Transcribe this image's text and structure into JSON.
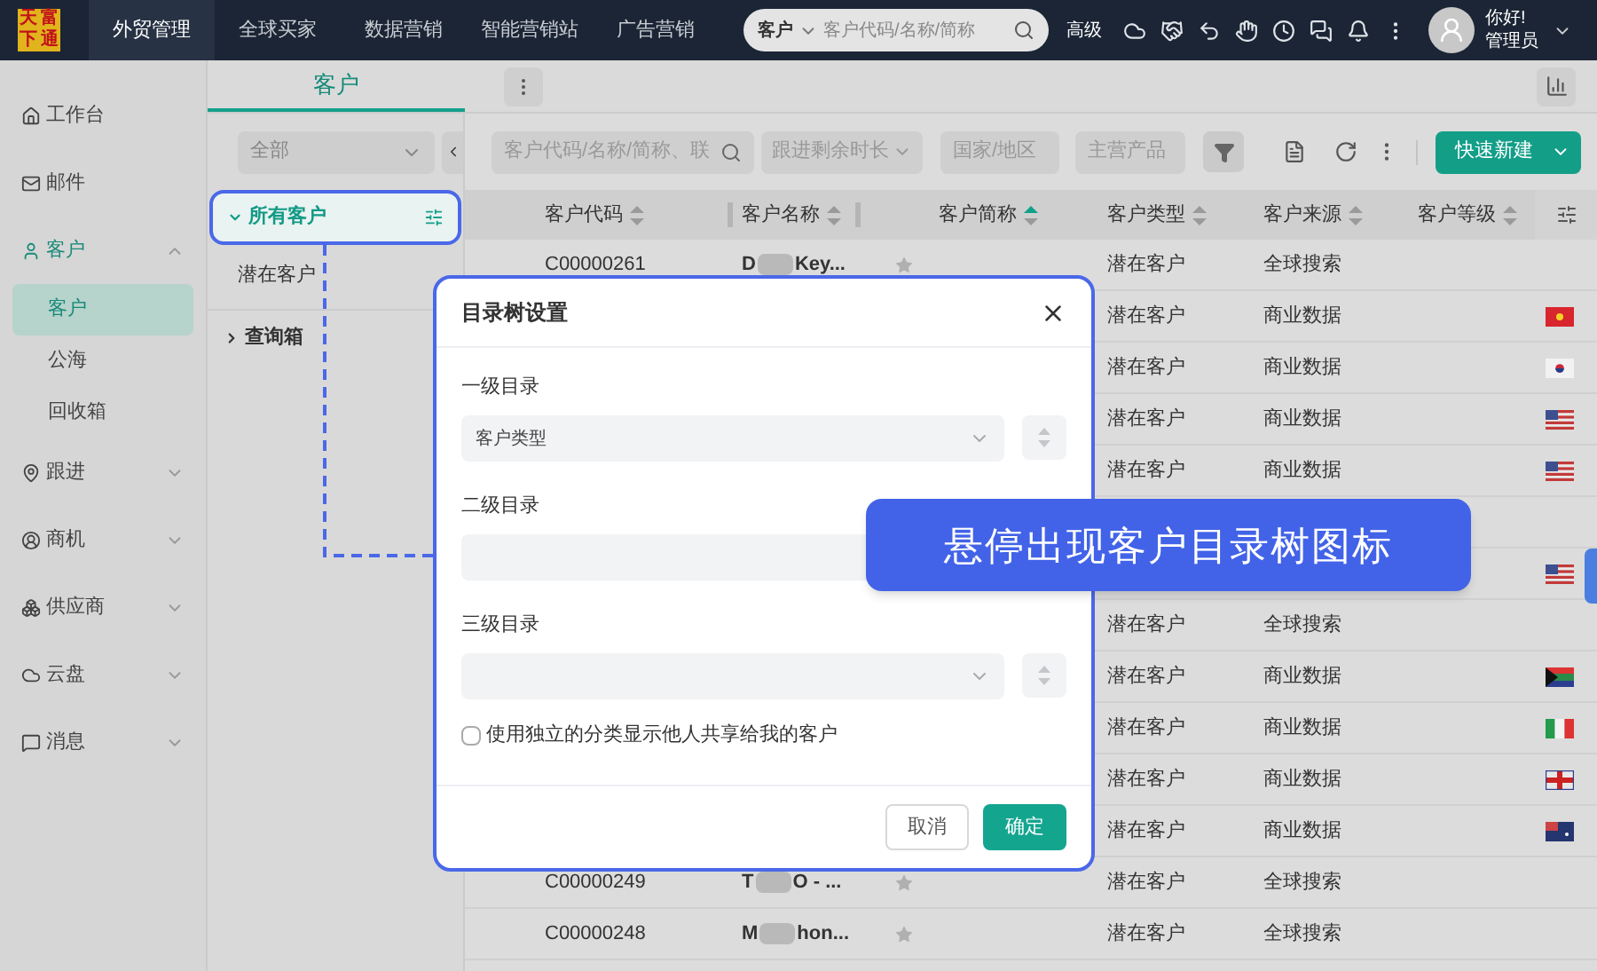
{
  "top_nav": {
    "logo": [
      "天",
      "富",
      "下",
      "通"
    ],
    "items": [
      {
        "label": "外贸管理",
        "selected": true
      },
      {
        "label": "全球买家",
        "selected": false
      },
      {
        "label": "数据营销",
        "selected": false
      },
      {
        "label": "智能营销站",
        "selected": false
      },
      {
        "label": "广告营销",
        "selected": false
      }
    ],
    "search": {
      "scope": "客户",
      "placeholder": "客户代码/名称/简称"
    },
    "advanced": "高级",
    "greeting": "你好!",
    "role": "管理员"
  },
  "sidebar": {
    "items": [
      {
        "label": "工作台"
      },
      {
        "label": "邮件"
      },
      {
        "label": "客户",
        "expanded": true,
        "children": [
          {
            "label": "客户",
            "selected": true
          },
          {
            "label": "公海",
            "selected": false
          },
          {
            "label": "回收箱",
            "selected": false
          }
        ]
      },
      {
        "label": "跟进",
        "expanded": false
      },
      {
        "label": "商机",
        "expanded": false
      },
      {
        "label": "供应商",
        "expanded": false
      },
      {
        "label": "云盘",
        "expanded": false
      },
      {
        "label": "消息",
        "expanded": false
      }
    ]
  },
  "tabs": [
    {
      "label": "客户",
      "selected": true
    }
  ],
  "tree": {
    "filter": "全部",
    "items": [
      {
        "label": "所有客户",
        "selected": true,
        "expanded": true,
        "children": [
          {
            "label": "潜在客户",
            "selected": false
          }
        ]
      },
      {
        "label": "查询箱",
        "selected": false,
        "expanded": false
      }
    ]
  },
  "toolbar": {
    "search_placeholder": "客户代码/名称/简称、联",
    "follow_select": "跟进剩余时长",
    "country_placeholder": "国家/地区",
    "product_placeholder": "主营产品",
    "new_button": "快速新建"
  },
  "table": {
    "columns": [
      {
        "label": "客户代码",
        "sorted": false
      },
      {
        "label": "客户名称",
        "sorted": false
      },
      {
        "label": "客户简称",
        "sorted": true
      },
      {
        "label": "客户类型",
        "sorted": false
      },
      {
        "label": "客户来源",
        "sorted": false
      },
      {
        "label": "客户等级",
        "sorted": false
      }
    ],
    "rows": [
      {
        "code": "C00000261",
        "name_start": "D",
        "name_end": "Key...",
        "starred": false,
        "type": "潜在客户",
        "source": "全球搜索"
      },
      {
        "type": "潜在客户",
        "source": "商业数据",
        "flag": {
          "kind": "vn"
        }
      },
      {
        "type": "潜在客户",
        "source": "商业数据",
        "flag": {
          "kind": "kr"
        }
      },
      {
        "type": "潜在客户",
        "source": "商业数据",
        "flag": {
          "kind": "us"
        }
      },
      {
        "type": "潜在客户",
        "source": "商业数据",
        "flag": {
          "kind": "us"
        }
      },
      {},
      {
        "flag": {
          "kind": "us"
        }
      },
      {
        "type": "潜在客户",
        "source": "全球搜索"
      },
      {
        "type": "潜在客户",
        "source": "商业数据",
        "flag": {
          "kind": "za"
        }
      },
      {
        "type": "潜在客户",
        "source": "商业数据",
        "flag": {
          "kind": "it"
        }
      },
      {
        "type": "潜在客户",
        "source": "商业数据",
        "flag": {
          "kind": "uk"
        }
      },
      {
        "type": "潜在客户",
        "source": "商业数据",
        "flag": {
          "kind": "au"
        }
      },
      {
        "code": "C00000249",
        "name_start": "T",
        "name_end": "O - ...",
        "starred": false,
        "type": "潜在客户",
        "source": "全球搜索"
      },
      {
        "code": "C00000248",
        "name_start": "M",
        "name_end": "hon...",
        "starred": false,
        "type": "潜在客户",
        "source": "全球搜索"
      }
    ]
  },
  "dialog": {
    "title": "目录树设置",
    "levels": [
      {
        "label": "一级目录",
        "value": "客户类型"
      },
      {
        "label": "二级目录"
      },
      {
        "label": "三级目录"
      }
    ],
    "checkbox": {
      "label": "使用独立的分类显示他人共享给我的客户",
      "checked": false
    },
    "cancel": "取消",
    "confirm": "确定"
  },
  "callout": "悬停出现客户目录树图标"
}
